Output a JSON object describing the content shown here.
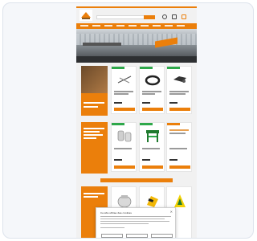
{
  "store": {
    "name": "",
    "brand_color": "#eb7f0b",
    "header_icons": [
      "user-icon",
      "heart-icon",
      "cart-icon"
    ]
  },
  "sections": [
    {
      "name": "featured-products",
      "promo_heading": "",
      "cards": 3
    },
    {
      "name": "category-products",
      "promo_heading": "",
      "cards": 3
    },
    {
      "name": "bottom-products",
      "promo_heading": "",
      "cards": 3
    }
  ],
  "cookie_banner": {
    "title": "Ce site utilise des cookies",
    "accept_label": "",
    "settings_label": "",
    "reject_label": ""
  },
  "colors": {
    "accent": "#eb7f0b",
    "badge": "#2ea84a",
    "page_bg": "#f1f1f1"
  }
}
